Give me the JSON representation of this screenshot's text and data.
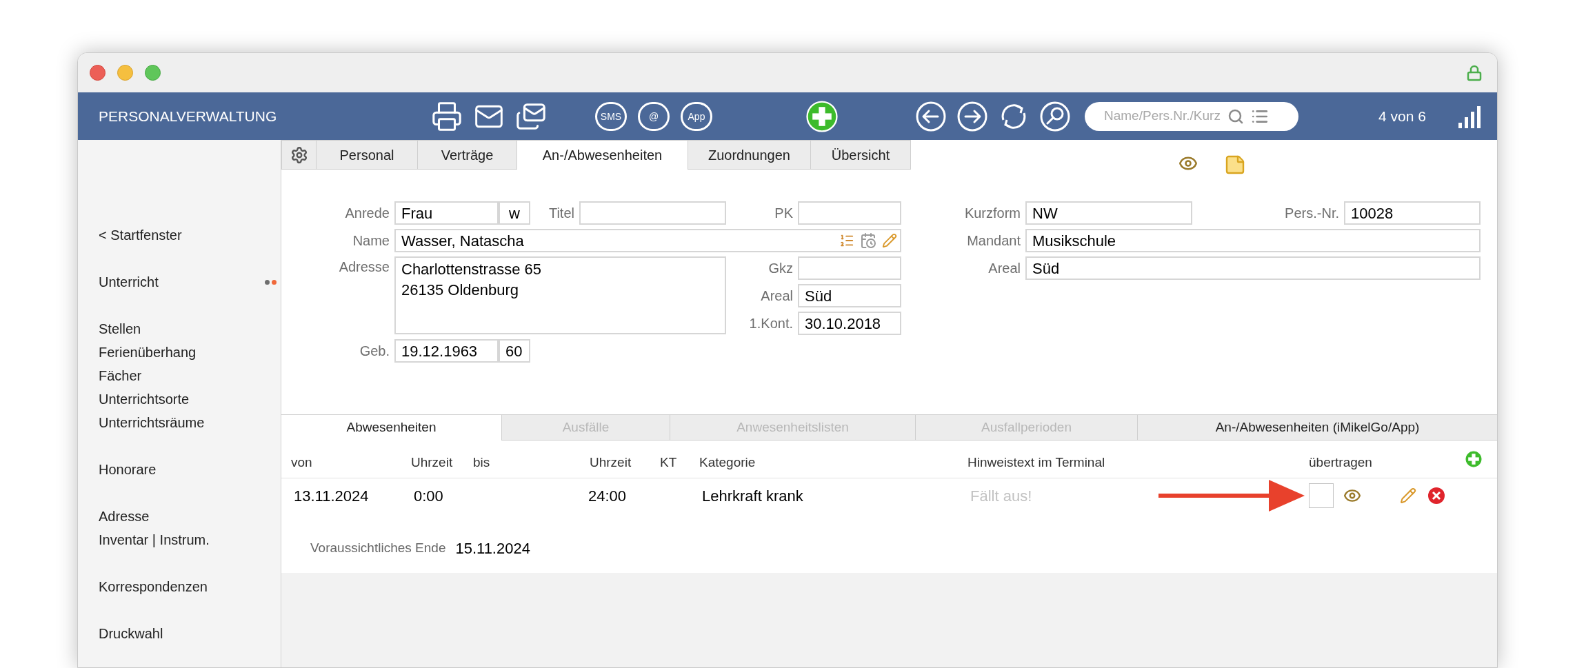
{
  "app_bar": {
    "title": "PERSONALVERWALTUNG",
    "bubble_labels": [
      "SMS",
      "@",
      "App"
    ],
    "search": {
      "placeholder": "Name/Pers.Nr./Kurz"
    },
    "record_position": "4 von 6"
  },
  "sidebar": {
    "groups": [
      {
        "items": [
          {
            "label": "< Startfenster",
            "marked": false
          }
        ]
      },
      {
        "items": [
          {
            "label": "Unterricht",
            "marked": true
          }
        ]
      },
      {
        "items": [
          {
            "label": "Stellen",
            "marked": false
          },
          {
            "label": "Ferienüberhang",
            "marked": false
          },
          {
            "label": "Fächer",
            "marked": false
          },
          {
            "label": "Unterrichtsorte",
            "marked": false
          },
          {
            "label": "Unterrichtsräume",
            "marked": false
          }
        ]
      },
      {
        "items": [
          {
            "label": "Honorare",
            "marked": false
          }
        ]
      },
      {
        "items": [
          {
            "label": "Adresse",
            "marked": false
          },
          {
            "label": "Inventar | Instrum.",
            "marked": false
          }
        ]
      },
      {
        "items": [
          {
            "label": "Korrespondenzen",
            "marked": false
          }
        ]
      },
      {
        "items": [
          {
            "label": "Druckwahl",
            "marked": false
          }
        ]
      }
    ]
  },
  "record_tabs": [
    {
      "label": "Personal",
      "selected": false
    },
    {
      "label": "Verträge",
      "selected": false
    },
    {
      "label": "An-/Abwesenheiten",
      "selected": true
    },
    {
      "label": "Zuordnungen",
      "selected": false
    },
    {
      "label": "Übersicht",
      "selected": false
    }
  ],
  "form": {
    "anrede": {
      "label": "Anrede",
      "value": "Frau",
      "suffix": "w"
    },
    "titel": {
      "label": "Titel"
    },
    "pk": {
      "label": "PK"
    },
    "name": {
      "label": "Name",
      "value": "Wasser, Natascha"
    },
    "adresse": {
      "label": "Adresse",
      "lines": [
        "Charlottenstrasse 65",
        "26135 Oldenburg"
      ]
    },
    "gkz": {
      "label": "Gkz"
    },
    "areal": {
      "label": "Areal",
      "value": "Süd"
    },
    "erster_kontakt": {
      "label": "1.Kont.",
      "value": "30.10.2018"
    },
    "geburtsdatum": {
      "label": "Geb.",
      "value": "19.12.1963",
      "suffix": "60"
    },
    "kurzform": {
      "label": "Kurzform",
      "value": "NW"
    },
    "pers_nr": {
      "label": "Pers.-Nr.",
      "value": "10028"
    },
    "mandant": {
      "label": "Mandant",
      "value": "Musikschule"
    },
    "areal_rechts": {
      "label": "Areal",
      "value": "Süd"
    }
  },
  "absence_tabs": [
    {
      "label": "Abwesenheiten",
      "selected": true,
      "disabled": false
    },
    {
      "label": "Ausfälle",
      "selected": false,
      "disabled": true
    },
    {
      "label": "Anwesenheitslisten",
      "selected": false,
      "disabled": true
    },
    {
      "label": "Ausfallperioden",
      "selected": false,
      "disabled": true
    },
    {
      "label": "An-/Abwesenheiten (iMikelGo/App)",
      "selected": false,
      "disabled": false
    }
  ],
  "table": {
    "columns": [
      "von",
      "Uhrzeit",
      "bis",
      "Uhrzeit",
      "KT",
      "Kategorie",
      "Hinweistext im Terminal",
      "übertragen"
    ],
    "rows": [
      {
        "von": "13.11.2024",
        "uhrzeit_von": "0:00",
        "uhrzeit_bis": "24:00",
        "kategorie": "Lehrkraft krank",
        "hinweistext": "Fällt aus!",
        "uebertragen": false
      }
    ]
  },
  "expected_end": {
    "label": "Voraussichtliches Ende",
    "value": "15.11.2024"
  }
}
